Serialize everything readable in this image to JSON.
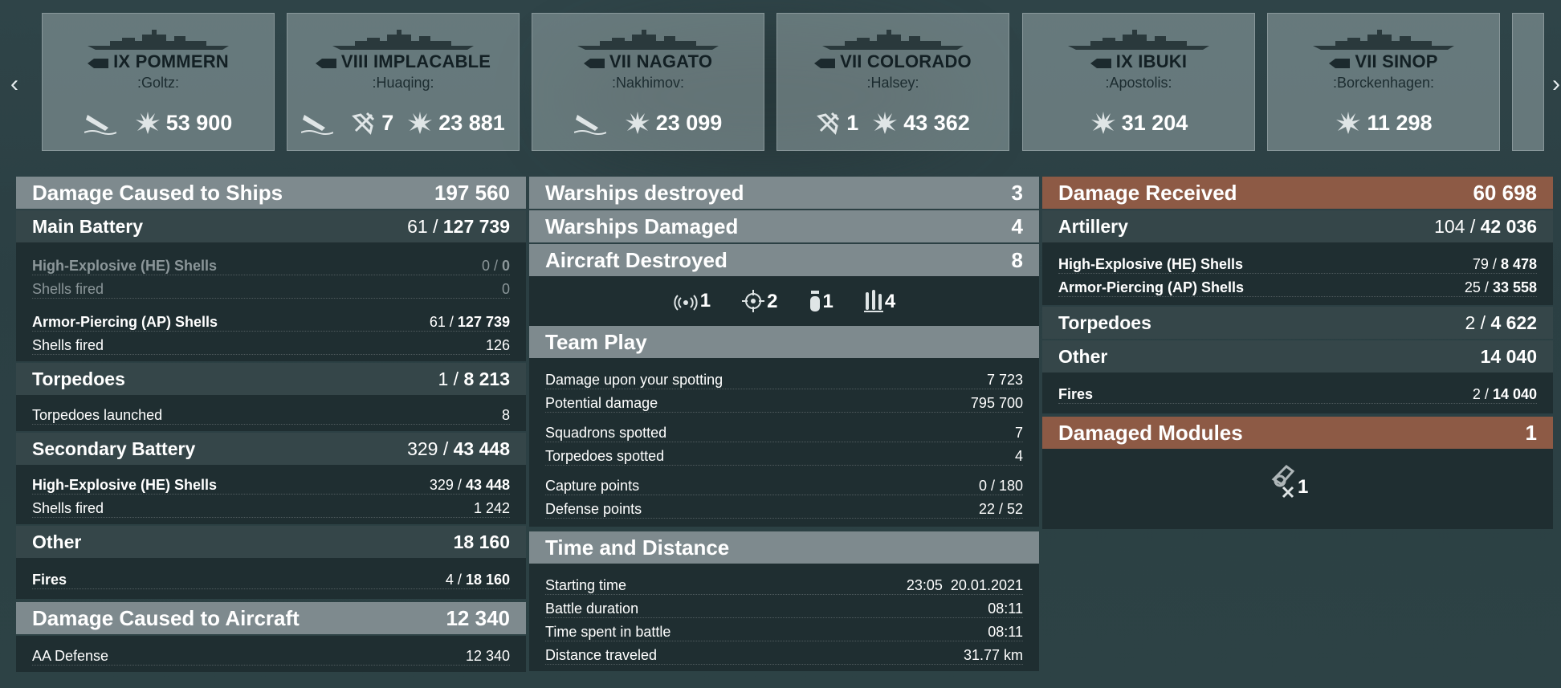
{
  "nav": {
    "prev": "‹",
    "next": "›"
  },
  "ships": [
    {
      "name": "IX POMMERN",
      "player": ":Goltz:",
      "stats": [
        {
          "icon": "sunk-icon",
          "value": ""
        },
        {
          "icon": "damage-icon",
          "value": "53 900"
        }
      ]
    },
    {
      "name": "VIII IMPLACABLE",
      "player": ":Huaqing:",
      "stats": [
        {
          "icon": "sunk-icon",
          "value": ""
        },
        {
          "icon": "planes-shot-icon",
          "value": "7"
        },
        {
          "icon": "damage-icon",
          "value": "23 881"
        }
      ]
    },
    {
      "name": "VII NAGATO",
      "player": ":Nakhimov:",
      "stats": [
        {
          "icon": "sunk-icon",
          "value": ""
        },
        {
          "icon": "damage-icon",
          "value": "23 099"
        }
      ]
    },
    {
      "name": "VII COLORADO",
      "player": ":Halsey:",
      "stats": [
        {
          "icon": "planes-shot-icon",
          "value": "1"
        },
        {
          "icon": "damage-icon",
          "value": "43 362"
        }
      ]
    },
    {
      "name": "IX IBUKI",
      "player": ":Apostolis:",
      "stats": [
        {
          "icon": "damage-icon",
          "value": "31 204"
        }
      ]
    },
    {
      "name": "VII SINOP",
      "player": ":Borckenhagen:",
      "stats": [
        {
          "icon": "damage-icon",
          "value": "11 298"
        }
      ]
    }
  ],
  "left": {
    "damage_ships": {
      "label": "Damage Caused to Ships",
      "value": "197 560"
    },
    "main_battery": {
      "label": "Main Battery",
      "hits": "61 /",
      "value": "127 739"
    },
    "he_label": "High-Explosive (HE) Shells",
    "he_hits": "0 /",
    "he_value": "0",
    "he_fired_label": "Shells fired",
    "he_fired": "0",
    "ap_label": "Armor-Piercing (AP) Shells",
    "ap_hits": "61 /",
    "ap_value": "127 739",
    "ap_fired_label": "Shells fired",
    "ap_fired": "126",
    "torpedoes": {
      "label": "Torpedoes",
      "hits": "1 /",
      "value": "8 213"
    },
    "torp_launched_label": "Torpedoes launched",
    "torp_launched": "8",
    "secondary": {
      "label": "Secondary Battery",
      "hits": "329 /",
      "value": "43 448"
    },
    "sec_he_label": "High-Explosive (HE) Shells",
    "sec_he_hits": "329 /",
    "sec_he_value": "43 448",
    "sec_fired_label": "Shells fired",
    "sec_fired": "1 242",
    "other": {
      "label": "Other",
      "value": "18 160"
    },
    "fires_label": "Fires",
    "fires_hits": "4 /",
    "fires_value": "18 160",
    "damage_aircraft": {
      "label": "Damage Caused to Aircraft",
      "value": "12 340"
    },
    "aa_label": "AA Defense",
    "aa_value": "12 340"
  },
  "mid": {
    "warships_destroyed": {
      "label": "Warships destroyed",
      "value": "3"
    },
    "warships_damaged": {
      "label": "Warships Damaged",
      "value": "4"
    },
    "aircraft_destroyed": {
      "label": "Aircraft Destroyed",
      "value": "8"
    },
    "ribbons": [
      {
        "icon": "spotted-icon",
        "value": "1"
      },
      {
        "icon": "crosshair-icon",
        "value": "2"
      },
      {
        "icon": "bomb-icon",
        "value": "1"
      },
      {
        "icon": "torpedo-icon",
        "value": "4"
      }
    ],
    "team_play": {
      "label": "Team Play"
    },
    "tp_rows": [
      {
        "label": "Damage upon your spotting",
        "value": "7 723"
      },
      {
        "label": "Potential damage",
        "value": "795 700"
      },
      {
        "label": "Squadrons spotted",
        "value": "7"
      },
      {
        "label": "Torpedoes spotted",
        "value": "4"
      },
      {
        "label": "Capture points",
        "value": "0 / 180"
      },
      {
        "label": "Defense points",
        "value": "22 / 52"
      }
    ],
    "time_distance": {
      "label": "Time and Distance"
    },
    "td_rows": [
      {
        "label": "Starting time",
        "value": "23:05  20.01.2021"
      },
      {
        "label": "Battle duration",
        "value": "08:11"
      },
      {
        "label": "Time spent in battle",
        "value": "08:11"
      },
      {
        "label": "Distance traveled",
        "value": "31.77 km"
      }
    ]
  },
  "right": {
    "damage_received": {
      "label": "Damage Received",
      "value": "60 698"
    },
    "artillery": {
      "label": "Artillery",
      "hits": "104 /",
      "value": "42 036"
    },
    "he_label": "High-Explosive (HE) Shells",
    "he_hits": "79 /",
    "he_value": "8 478",
    "ap_label": "Armor-Piercing (AP) Shells",
    "ap_hits": "25 /",
    "ap_value": "33 558",
    "torpedoes": {
      "label": "Torpedoes",
      "hits": "2 /",
      "value": "4 622"
    },
    "other": {
      "label": "Other",
      "value": "14 040"
    },
    "fires_label": "Fires",
    "fires_hits": "2 /",
    "fires_value": "14 040",
    "damaged_modules": {
      "label": "Damaged Modules",
      "value": "1"
    },
    "module_count": "1"
  },
  "colors": {
    "header_gray": "#7e8a8e",
    "header_orange": "#8d5a45",
    "panel": "#1f2e31"
  }
}
